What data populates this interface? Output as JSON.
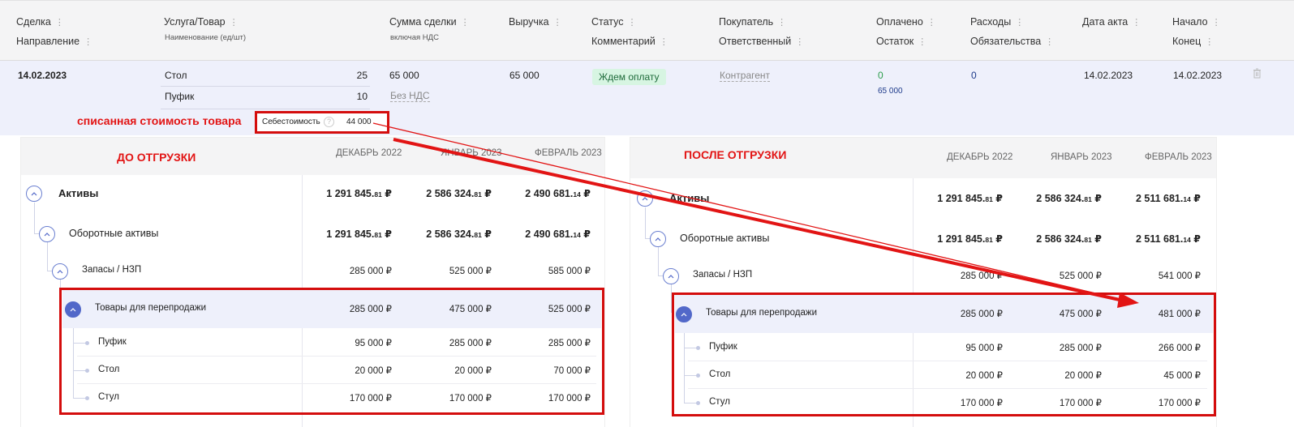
{
  "header": {
    "cols": [
      {
        "top": "Сделка",
        "bottom": "Направление"
      },
      {
        "top": "Услуга/Товар",
        "sub": "Наименование (ед/шт)"
      },
      {
        "top": "Сумма сделки",
        "sub": "включая НДС"
      },
      {
        "top": "Выручка"
      },
      {
        "top": "Статус",
        "bottom": "Комментарий"
      },
      {
        "top": "Покупатель",
        "bottom": "Ответственный"
      },
      {
        "top": "Оплачено",
        "bottom": "Остаток"
      },
      {
        "top": "Расходы",
        "bottom": "Обязательства"
      },
      {
        "top": "Дата акта"
      },
      {
        "top": "Начало",
        "bottom": "Конец"
      }
    ]
  },
  "deal": {
    "date": "14.02.2023",
    "items": [
      {
        "name": "Стол",
        "qty": "25"
      },
      {
        "name": "Пуфик",
        "qty": "10"
      }
    ],
    "sum": "65 000",
    "vat": "Без НДС",
    "revenue": "65 000",
    "status": "Ждем оплату",
    "buyer": "Контрагент",
    "paid": "0",
    "remaining": "65 000",
    "expenses": "0",
    "act_date": "14.02.2023",
    "start": "14.02.2023",
    "cost_label": "Себестоимость",
    "cost_help": "?",
    "cost_value": "44 000"
  },
  "annotation": "списанная стоимость товара",
  "panels": [
    {
      "title": "ДО ОТГРУЗКИ",
      "cols": [
        "ДЕКАБРЬ 2022",
        "ЯНВАРЬ 2023",
        "ФЕВРАЛЬ 2023"
      ],
      "rows": [
        {
          "label": "Активы",
          "v": [
            [
              "1 291 845.",
              "81",
              " ₽"
            ],
            [
              "2 586 324.",
              "81",
              " ₽"
            ],
            [
              "2 490 681.",
              "14",
              " ₽"
            ]
          ]
        },
        {
          "label": "Оборотные активы",
          "v": [
            [
              "1 291 845.",
              "81",
              " ₽"
            ],
            [
              "2 586 324.",
              "81",
              " ₽"
            ],
            [
              "2 490 681.",
              "14",
              " ₽"
            ]
          ]
        },
        {
          "label": "Запасы / НЗП",
          "v": [
            "285 000 ₽",
            "525 000 ₽",
            "585 000 ₽"
          ]
        },
        {
          "label": "Товары для перепродажи",
          "v": [
            "285 000 ₽",
            "475 000 ₽",
            "525 000 ₽"
          ]
        },
        {
          "label": "Пуфик",
          "v": [
            "95 000 ₽",
            "285 000 ₽",
            "285 000 ₽"
          ]
        },
        {
          "label": "Стол",
          "v": [
            "20 000 ₽",
            "20 000 ₽",
            "70 000 ₽"
          ]
        },
        {
          "label": "Стул",
          "v": [
            "170 000 ₽",
            "170 000 ₽",
            "170 000 ₽"
          ]
        }
      ]
    },
    {
      "title": "ПОСЛЕ ОТГРУЗКИ",
      "cols": [
        "ДЕКАБРЬ 2022",
        "ЯНВАРЬ 2023",
        "ФЕВРАЛЬ 2023"
      ],
      "rows": [
        {
          "label": "Активы",
          "v": [
            [
              "1 291 845.",
              "81",
              " ₽"
            ],
            [
              "2 586 324.",
              "81",
              " ₽"
            ],
            [
              "2 511 681.",
              "14",
              " ₽"
            ]
          ]
        },
        {
          "label": "Оборотные активы",
          "v": [
            [
              "1 291 845.",
              "81",
              " ₽"
            ],
            [
              "2 586 324.",
              "81",
              " ₽"
            ],
            [
              "2 511 681.",
              "14",
              " ₽"
            ]
          ]
        },
        {
          "label": "Запасы / НЗП",
          "v": [
            "285 000 ₽",
            "525 000 ₽",
            "541 000 ₽"
          ]
        },
        {
          "label": "Товары для перепродажи",
          "v": [
            "285 000 ₽",
            "475 000 ₽",
            "481 000 ₽"
          ]
        },
        {
          "label": "Пуфик",
          "v": [
            "95 000 ₽",
            "285 000 ₽",
            "266 000 ₽"
          ]
        },
        {
          "label": "Стол",
          "v": [
            "20 000 ₽",
            "20 000 ₽",
            "45 000 ₽"
          ]
        },
        {
          "label": "Стул",
          "v": [
            "170 000 ₽",
            "170 000 ₽",
            "170 000 ₽"
          ]
        }
      ]
    }
  ],
  "colors": {
    "accent": "#5268c9",
    "highlight": "#d40d0d",
    "status_bg": "#d7f5e2"
  }
}
